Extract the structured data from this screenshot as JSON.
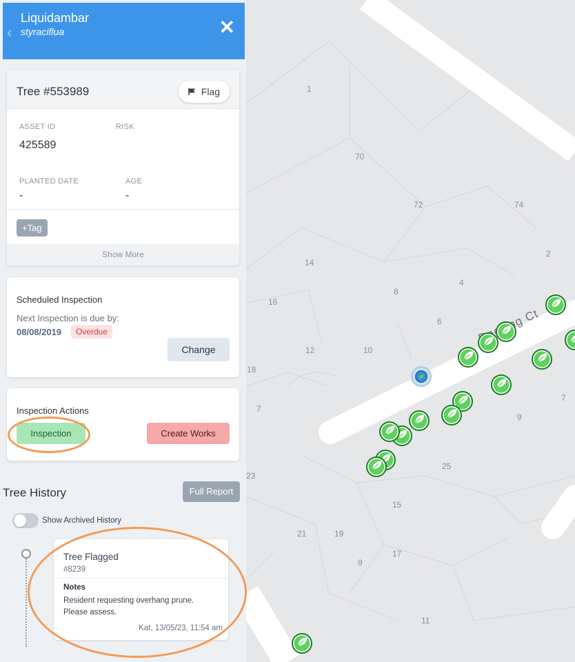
{
  "header": {
    "common_name": "Liquidambar",
    "latin_name": "styraciflua",
    "back_glyph": "‹",
    "close_glyph": "✕"
  },
  "tree": {
    "title": "Tree #553989",
    "flag_label": "Flag",
    "asset_id_label": "ASSET ID",
    "asset_id_value": "425589",
    "risk_label": "RISK",
    "planted_label": "PLANTED DATE",
    "planted_value": "-",
    "age_label": "AGE",
    "age_value": "-",
    "tag_label": "+Tag",
    "show_more_label": "Show More"
  },
  "scheduled": {
    "title": "Scheduled Inspection",
    "due_label": "Next Inspection is due by:",
    "due_date": "08/08/2019",
    "status_badge": "Overdue",
    "change_label": "Change"
  },
  "actions": {
    "title": "Inspection Actions",
    "inspection_label": "Inspection",
    "create_works_label": "Create Works"
  },
  "history": {
    "title": "Tree History",
    "full_report_label": "Full Report",
    "archived_toggle_label": "Show Archived History",
    "archived_toggle_on": false,
    "entries": [
      {
        "title": "Tree Flagged",
        "id": "#8239",
        "notes_label": "Notes",
        "notes": "Resident requesting overhang prune. Please assess.",
        "meta": "Kat, 13/05/23, 11:54 am"
      }
    ]
  },
  "map": {
    "street_name": "Docking Ct",
    "parcel_numbers": [
      "1",
      "70",
      "72",
      "74",
      "2",
      "14",
      "8",
      "4",
      "16",
      "6",
      "12",
      "10",
      "18",
      "7",
      "9",
      "25",
      "23",
      "15",
      "21",
      "19",
      "17",
      "9",
      "11",
      "7"
    ]
  },
  "colors": {
    "header_blue": "#3d95ea",
    "tree_marker_green": "#5ed15e",
    "overdue_red": "#d9363e",
    "inspection_green": "#a8e6b6",
    "create_works_red": "#f6a9a9",
    "annotation_orange": "#f39a56"
  },
  "icons": {
    "flag": "flag-icon",
    "tree_marker": "leaf-icon",
    "close": "close-icon",
    "back": "chevron-left-icon"
  }
}
